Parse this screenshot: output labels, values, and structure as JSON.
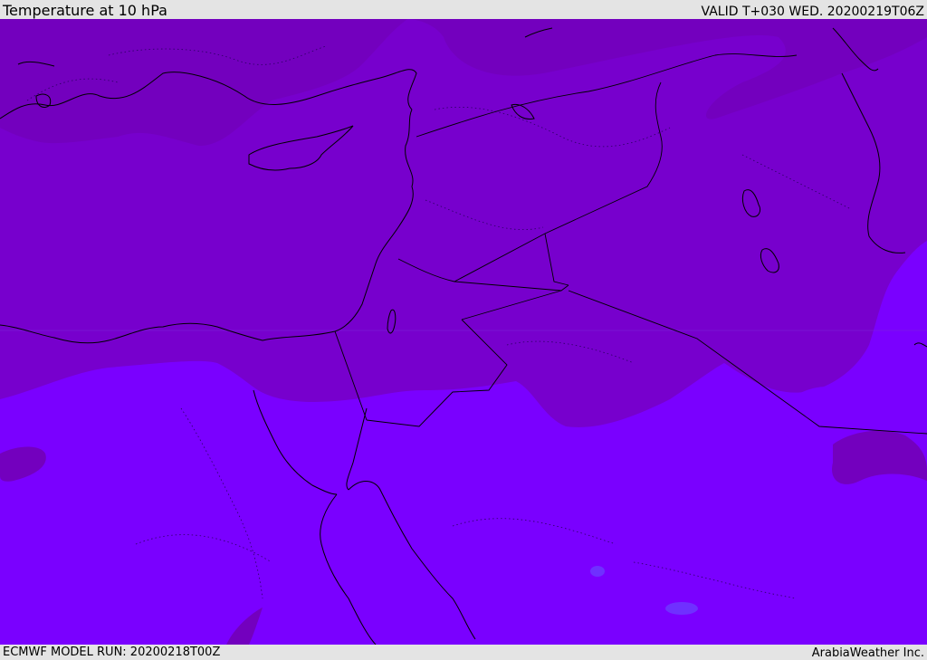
{
  "header": {
    "title": "Temperature at 10 hPa",
    "valid": "VALID T+030 WED. 20200219T06Z"
  },
  "footer": {
    "model_run": "ECMWF MODEL RUN: 20200218T00Z",
    "credit": "ArabiaWeather Inc."
  },
  "colors": {
    "band_cold": "#7700cd",
    "band_mid": "#7300be",
    "band_warm": "#7a00ff",
    "band_warmer": "#6f30ff",
    "coastline": "#000000",
    "frame": "#e4e4e4"
  }
}
